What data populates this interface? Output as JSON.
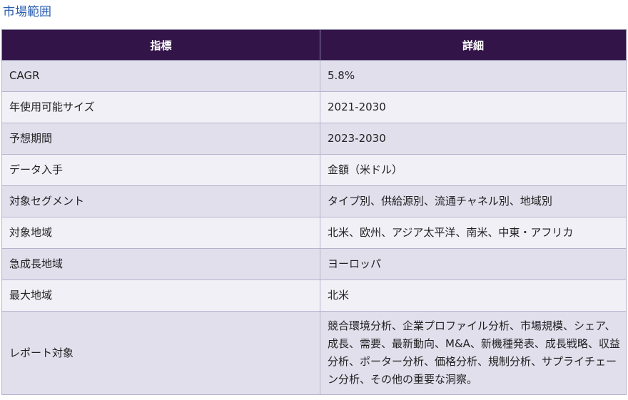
{
  "heading": "市場範囲",
  "table": {
    "headers": [
      "指標",
      "詳細"
    ],
    "rows": [
      {
        "metric": "CAGR",
        "detail": "5.8%"
      },
      {
        "metric": "年使用可能サイズ",
        "detail": "2021-2030"
      },
      {
        "metric": "予想期間",
        "detail": "2023-2030"
      },
      {
        "metric": "データ入手",
        "detail": "金額（米ドル）"
      },
      {
        "metric": "対象セグメント",
        "detail": "タイプ別、供給源別、流通チャネル別、地域別"
      },
      {
        "metric": "対象地域",
        "detail": "北米、欧州、アジア太平洋、南米、中東・アフリカ"
      },
      {
        "metric": "急成長地域",
        "detail": "ヨーロッパ"
      },
      {
        "metric": "最大地域",
        "detail": "北米"
      },
      {
        "metric": "レポート対象",
        "detail": "競合環境分析、企業プロファイル分析、市場規模、シェア、成長、需要、最新動向、M&A、新機種発表、成長戦略、収益分析、ポーター分析、価格分析、規制分析、サプライチェーン分析、その他の重要な洞察。"
      }
    ]
  }
}
